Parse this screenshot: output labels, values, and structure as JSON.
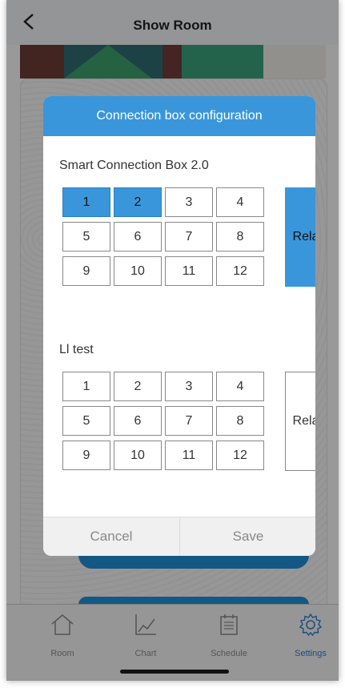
{
  "header": {
    "title": "Show Room"
  },
  "modal": {
    "title": "Connection box configuration",
    "boxes": [
      {
        "name": "Smart Connection Box 2.0",
        "cells": [
          "1",
          "2",
          "3",
          "4",
          "5",
          "6",
          "7",
          "8",
          "9",
          "10",
          "11",
          "12"
        ],
        "selected": [
          true,
          true,
          false,
          false,
          false,
          false,
          false,
          false,
          false,
          false,
          false,
          false
        ],
        "relay_label": "Relay",
        "relay_selected": true
      },
      {
        "name": "Ll test",
        "cells": [
          "1",
          "2",
          "3",
          "4",
          "5",
          "6",
          "7",
          "8",
          "9",
          "10",
          "11",
          "12"
        ],
        "selected": [
          false,
          false,
          false,
          false,
          false,
          false,
          false,
          false,
          false,
          false,
          false,
          false
        ],
        "relay_label": "Relay",
        "relay_selected": false
      }
    ],
    "cancel_label": "Cancel",
    "save_label": "Save"
  },
  "tabs": [
    {
      "label": "Room",
      "icon": "home-icon",
      "active": false
    },
    {
      "label": "Chart",
      "icon": "chart-icon",
      "active": false
    },
    {
      "label": "Schedule",
      "icon": "schedule-icon",
      "active": false
    },
    {
      "label": "Settings",
      "icon": "gear-icon",
      "active": true
    }
  ],
  "colors": {
    "accent": "#3a96db",
    "active_tab": "#2a7ccf"
  }
}
